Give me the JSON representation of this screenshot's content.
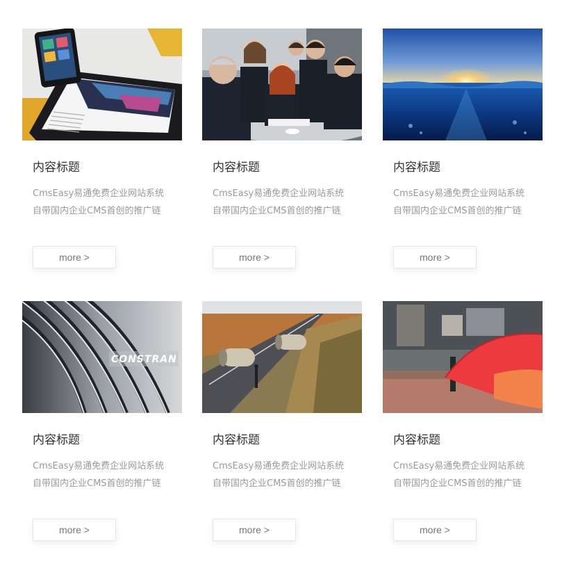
{
  "cards": [
    {
      "image": "tablet-and-phone-devices-image",
      "title": "内容标题",
      "desc_line1": "CmsEasy易通免费企业网站系统",
      "desc_line2": "自带国内企业CMS首创的推广链",
      "more_label": "more >"
    },
    {
      "image": "business-team-meeting-image",
      "title": "内容标题",
      "desc_line1": "CmsEasy易通免费企业网站系统",
      "desc_line2": "自带国内企业CMS首创的推广链",
      "more_label": "more >"
    },
    {
      "image": "ocean-sunrise-underwater-image",
      "title": "内容标题",
      "desc_line1": "CmsEasy易通免费企业网站系统",
      "desc_line2": "自带国内企业CMS首创的推广链",
      "more_label": "more >"
    },
    {
      "image": "constran-architecture-image",
      "logo_text": "CONSTRAN",
      "title": "内容标题",
      "desc_line1": "CmsEasy易通免费企业网站系统",
      "desc_line2": "自带国内企业CMS首创的推广链",
      "more_label": "more >"
    },
    {
      "image": "road-field-pipes-image",
      "title": "内容标题",
      "desc_line1": "CmsEasy易通免费企业网站系统",
      "desc_line2": "自带国内企业CMS首创的推广链",
      "more_label": "more >"
    },
    {
      "image": "red-umbrella-street-image",
      "title": "内容标题",
      "desc_line1": "CmsEasy易通免费企业网站系统",
      "desc_line2": "自带国内企业CMS首创的推广链",
      "more_label": "more >"
    }
  ]
}
